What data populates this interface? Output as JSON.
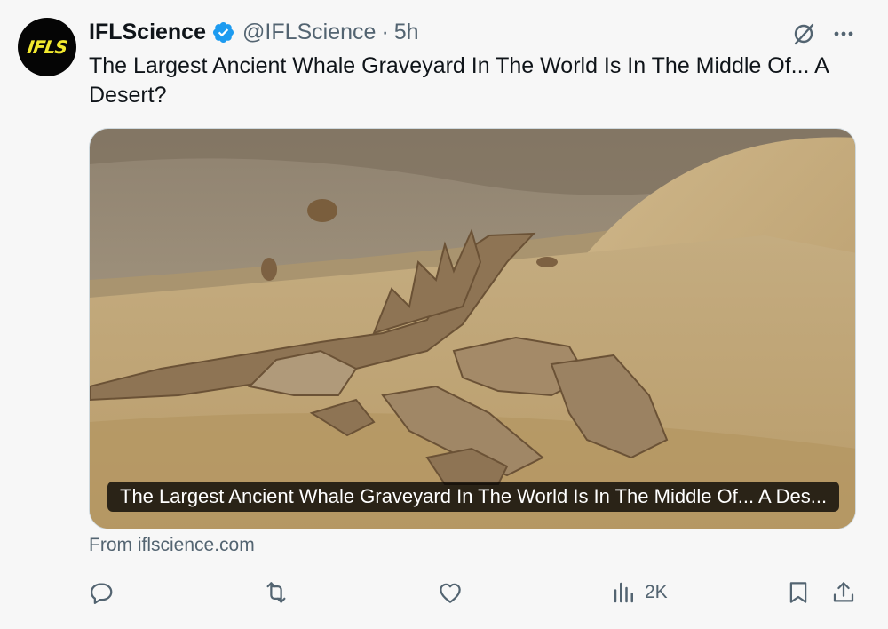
{
  "account": {
    "avatar_text": "IFLS",
    "display_name": "IFLScience",
    "handle": "@IFLScience",
    "separator": "·",
    "time": "5h",
    "verified_color": "#1d9bf0"
  },
  "tweet": {
    "text": "The Largest Ancient Whale Graveyard In The World Is In The Middle Of... A Desert?"
  },
  "card": {
    "title": "The Largest Ancient Whale Graveyard In The World Is In The Middle Of... A Des...",
    "image_alt": "whale fossil skeleton in desert sand",
    "source": "From iflscience.com"
  },
  "actions": {
    "reply_icon": "reply-icon",
    "retweet_icon": "retweet-icon",
    "like_icon": "heart-icon",
    "views_icon": "views-icon",
    "views_count": "2K",
    "bookmark_icon": "bookmark-icon",
    "share_icon": "share-icon"
  },
  "colors": {
    "text_primary": "#0f1419",
    "text_secondary": "#536471",
    "background": "#f7f7f7"
  }
}
